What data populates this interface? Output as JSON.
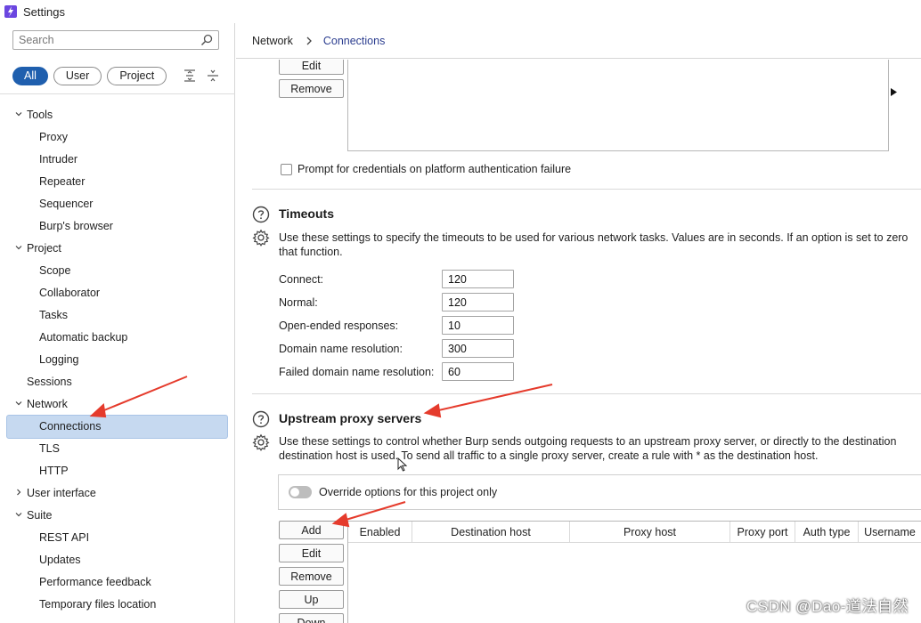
{
  "app": {
    "title": "Settings"
  },
  "sidebar": {
    "search_placeholder": "Search",
    "filters": [
      {
        "label": "All",
        "active": true
      },
      {
        "label": "User",
        "active": false
      },
      {
        "label": "Project",
        "active": false
      }
    ],
    "tree": [
      {
        "label": "Tools",
        "level": 0,
        "expanded": true
      },
      {
        "label": "Proxy",
        "level": 1
      },
      {
        "label": "Intruder",
        "level": 1
      },
      {
        "label": "Repeater",
        "level": 1
      },
      {
        "label": "Sequencer",
        "level": 1
      },
      {
        "label": "Burp's browser",
        "level": 1
      },
      {
        "label": "Project",
        "level": 0,
        "expanded": true
      },
      {
        "label": "Scope",
        "level": 1
      },
      {
        "label": "Collaborator",
        "level": 1
      },
      {
        "label": "Tasks",
        "level": 1
      },
      {
        "label": "Automatic backup",
        "level": 1
      },
      {
        "label": "Logging",
        "level": 1
      },
      {
        "label": "Sessions",
        "level": 0
      },
      {
        "label": "Network",
        "level": 0,
        "expanded": true
      },
      {
        "label": "Connections",
        "level": 1,
        "selected": true
      },
      {
        "label": "TLS",
        "level": 1
      },
      {
        "label": "HTTP",
        "level": 1
      },
      {
        "label": "User interface",
        "level": 0,
        "expanded": false
      },
      {
        "label": "Suite",
        "level": 0,
        "expanded": true
      },
      {
        "label": "REST API",
        "level": 1
      },
      {
        "label": "Updates",
        "level": 1
      },
      {
        "label": "Performance feedback",
        "level": 1
      },
      {
        "label": "Temporary files location",
        "level": 1
      }
    ]
  },
  "header": {
    "breadcrumb": [
      "Network",
      "Connections"
    ]
  },
  "platform_auth": {
    "edit_label": "Edit",
    "remove_label": "Remove",
    "prompt_label": "Prompt for credentials on platform authentication failure",
    "prompt_checked": false
  },
  "timeouts": {
    "title": "Timeouts",
    "desc_line1": "Use these settings to specify the timeouts to be used for various network tasks. Values are in seconds. If an option is set to zero",
    "desc_line2": "that function.",
    "fields": [
      {
        "label": "Connect:",
        "value": "120"
      },
      {
        "label": "Normal:",
        "value": "120"
      },
      {
        "label": "Open-ended responses:",
        "value": "10"
      },
      {
        "label": "Domain name resolution:",
        "value": "300"
      },
      {
        "label": "Failed domain name resolution:",
        "value": "60"
      }
    ]
  },
  "upstream": {
    "title": "Upstream proxy servers",
    "desc_line1": "Use these settings to  control whether Burp sends outgoing requests to an upstream proxy server, or directly to the destination",
    "desc_line2": "destination host is used. To send all traffic to a single proxy server, create a rule with * as the destination host.",
    "override_label": "Override options for this project only",
    "override_on": false,
    "buttons": [
      "Add",
      "Edit",
      "Remove",
      "Up",
      "Down"
    ],
    "columns": [
      "Enabled",
      "Destination host",
      "Proxy host",
      "Proxy port",
      "Auth type",
      "Username"
    ]
  },
  "watermark": "CSDN @Dao-道法自然",
  "colors": {
    "accent": "#1f5fae",
    "selected_bg": "#c6d9f0",
    "annotation": "#e53b2c"
  }
}
